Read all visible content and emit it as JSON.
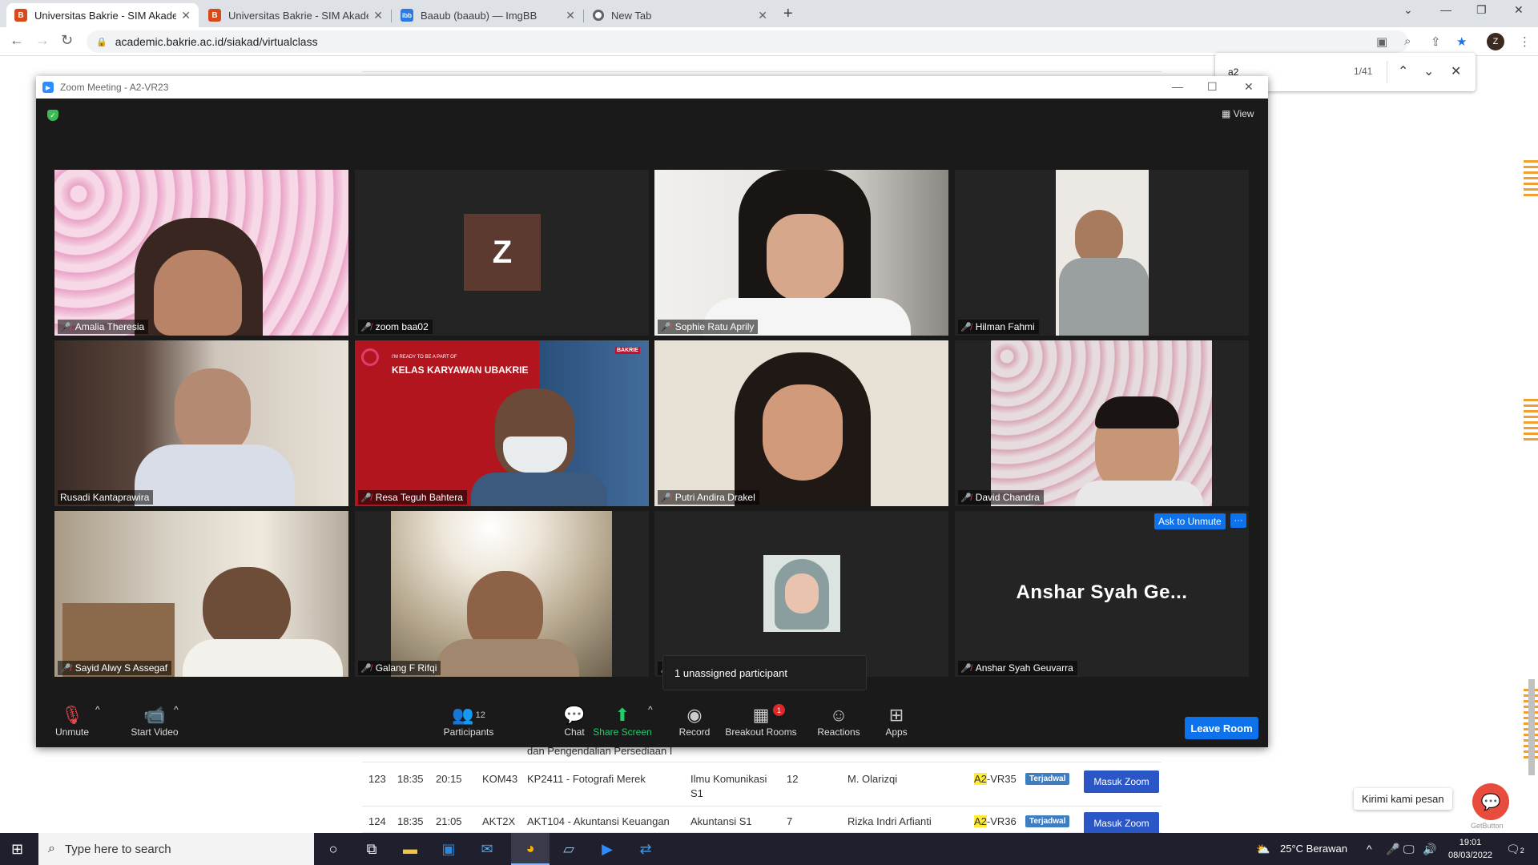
{
  "browser": {
    "tabs": [
      {
        "label": "Universitas Bakrie - SIM Akadem",
        "icon": "ub-favicon",
        "active": true
      },
      {
        "label": "Universitas Bakrie - SIM Akadem",
        "icon": "ub-favicon",
        "active": false
      },
      {
        "label": "Baaub (baaub) — ImgBB",
        "icon": "imgbb-favicon",
        "active": false
      },
      {
        "label": "New Tab",
        "icon": "chrome-favicon",
        "active": false
      }
    ],
    "new_tab": "+",
    "url": "academic.bakrie.ac.id/siakad/virtualclass",
    "profile_initial": "Z",
    "find": {
      "query": "a2",
      "count": "1/41"
    }
  },
  "zoom": {
    "title": "Zoom Meeting - A2-VR23",
    "view_label": "View",
    "participants_tiles": [
      {
        "name": "Amalia Theresia",
        "muted": true
      },
      {
        "name": "zoom baa02",
        "muted": true,
        "avatar_letter": "Z"
      },
      {
        "name": "Sophie Ratu Aprily",
        "muted": true
      },
      {
        "name": "Hilman Fahmi",
        "muted": true
      },
      {
        "name": "Rusadi Kantaprawira",
        "muted": false
      },
      {
        "name": "Resa Teguh Bahtera",
        "muted": true
      },
      {
        "name": "Putri Andira Drakel",
        "muted": true
      },
      {
        "name": "David Chandra",
        "muted": true
      },
      {
        "name": "Sayid Alwy S Assegaf",
        "muted": true
      },
      {
        "name": "Galang F Rifqi",
        "muted": true
      },
      {
        "name": "",
        "muted": true
      },
      {
        "name": "Anshar Syah Geuvarra",
        "muted": true,
        "big_label": "Anshar Syah Ge..."
      }
    ],
    "banner_small": "I'M READY TO BE A PART OF",
    "banner_title": "KELAS KARYAWAN UBAKRIE",
    "banner_logo": "BAKRIE",
    "ask_unmute": "Ask to Unmute",
    "more": "···",
    "unassigned": "1 unassigned participant",
    "controls": {
      "unmute": "Unmute",
      "start_video": "Start Video",
      "participants": "Participants",
      "participants_count": "12",
      "chat": "Chat",
      "share_screen": "Share Screen",
      "record": "Record",
      "breakout_rooms": "Breakout Rooms",
      "breakout_badge": "1",
      "reactions": "Reactions",
      "apps": "Apps",
      "leave": "Leave Room"
    }
  },
  "background_table": {
    "partial_text": "dan Pengendalian Persediaan I",
    "rows": [
      {
        "no": "123",
        "start": "18:35",
        "end": "20:15",
        "code": "KOM43",
        "course": "KP2411 - Fotografi Merek",
        "program_l1": "Ilmu Komunikasi",
        "program_l2": "S1",
        "count": "12",
        "lecturer": "M. Olarizqi",
        "room_hl": "A2",
        "room_rest": "-VR35",
        "status": "Terjadwal",
        "action": "Masuk Zoom"
      },
      {
        "no": "124",
        "start": "18:35",
        "end": "21:05",
        "code": "AKT2X",
        "course": "AKT104 - Akuntansi Keuangan",
        "program_l1": "Akuntansi S1",
        "program_l2": "",
        "count": "7",
        "lecturer": "Rizka Indri Arfianti",
        "room_hl": "A2",
        "room_rest": "-VR36",
        "status": "Terjadwal",
        "action": "Masuk Zoom"
      }
    ]
  },
  "chat_widget": {
    "tooltip": "Kirimi kami pesan",
    "brand": "GetButton"
  },
  "taskbar": {
    "search_placeholder": "Type here to search",
    "weather": "25°C  Berawan",
    "time": "19:01",
    "date": "08/03/2022",
    "notifications": "2"
  }
}
